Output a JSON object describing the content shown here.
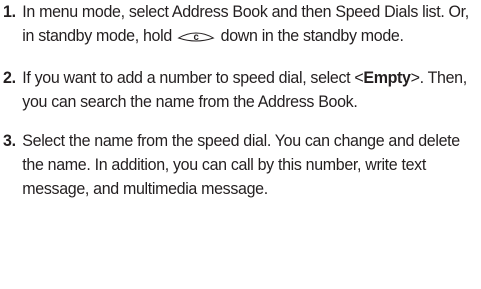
{
  "steps": [
    {
      "number": "1.",
      "text_before_key": "In menu mode, select Address Book and then Speed Dials list. Or, in standby mode, hold ",
      "key_icon": "clear-key-icon",
      "key_label": "c",
      "text_after_key": " down in the standby mode."
    },
    {
      "number": "2.",
      "text_1": "If you want to add a number to speed dial, select <",
      "bold_text": "Empty",
      "text_2": ">. Then, you can search the name from the Address Book."
    },
    {
      "number": "3.",
      "text": "Select the name from the speed dial. You can change and delete the name. In addition, you can call by this number, write text message, and multimedia message."
    }
  ]
}
